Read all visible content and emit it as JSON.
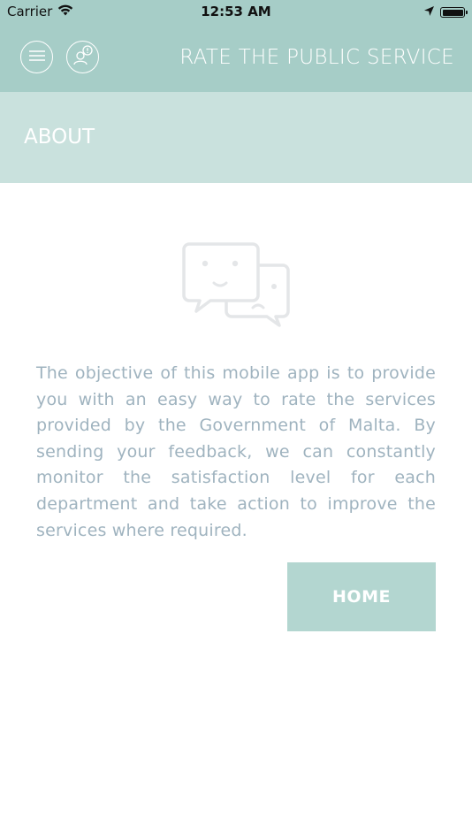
{
  "status_bar": {
    "carrier": "Carrier",
    "time": "12:53 AM",
    "icons": [
      "wifi-icon",
      "location-arrow-icon",
      "battery-icon"
    ]
  },
  "header": {
    "title": "RATE THE PUBLIC SERVICE",
    "buttons": [
      "menu-icon",
      "feedback-user-icon"
    ],
    "background_color": "#a6cdc7"
  },
  "section": {
    "title": "ABOUT",
    "background_color": "#c9e1dd"
  },
  "content": {
    "illustration": "chat-bubbles-icon",
    "description": "The objective of this mobile app is to provide you with an easy way to rate the services provided by the Government of Malta. By sending your feedback, we can constantly monitor the satisfaction level for each department and take action to improve the services where required.",
    "text_color": "#9fb3bf"
  },
  "actions": {
    "home_label": "HOME",
    "home_color": "#b3d6d0"
  }
}
